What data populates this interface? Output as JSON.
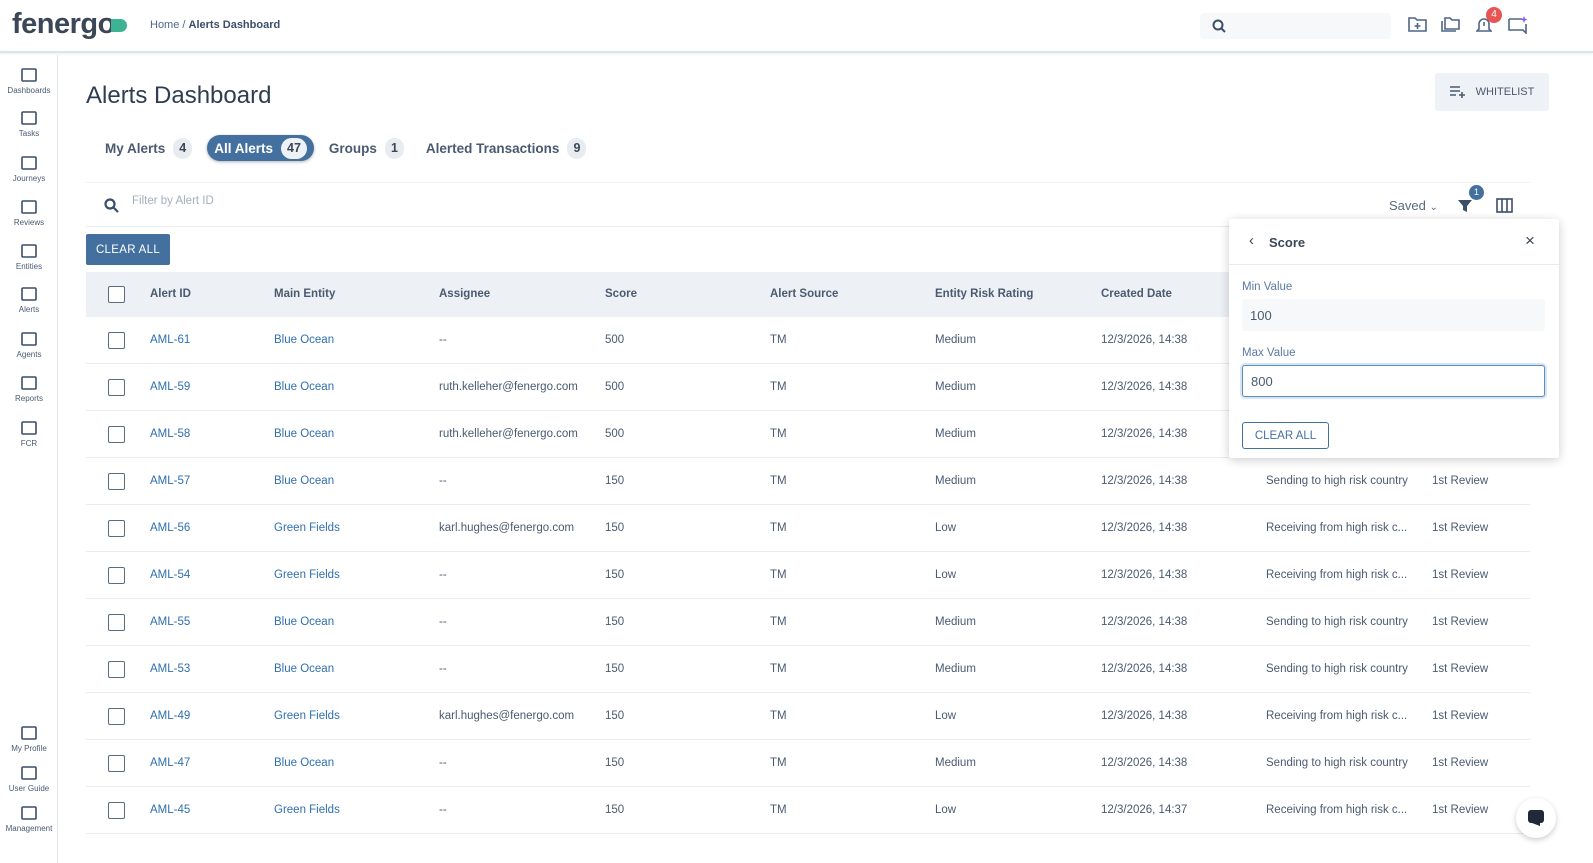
{
  "header": {
    "logo": "fenergo",
    "breadcrumb_home": "Home",
    "breadcrumb_sep": " / ",
    "breadcrumb_current": "Alerts Dashboard",
    "notification_count": "4"
  },
  "sidebar": {
    "items": [
      {
        "label": "Dashboards",
        "icon": "dashboard-icon"
      },
      {
        "label": "Tasks",
        "icon": "tasks-icon"
      },
      {
        "label": "Journeys",
        "icon": "journeys-icon"
      },
      {
        "label": "Reviews",
        "icon": "reviews-icon"
      },
      {
        "label": "Entities",
        "icon": "entities-icon"
      },
      {
        "label": "Alerts",
        "icon": "alerts-icon"
      },
      {
        "label": "Agents",
        "icon": "agents-icon"
      },
      {
        "label": "Reports",
        "icon": "reports-icon"
      },
      {
        "label": "FCR",
        "icon": "fcr-icon"
      }
    ],
    "bottom": [
      {
        "label": "My Profile",
        "icon": "profile-icon"
      },
      {
        "label": "User Guide",
        "icon": "book-icon"
      },
      {
        "label": "Management",
        "icon": "gear-icon"
      }
    ]
  },
  "page": {
    "title": "Alerts Dashboard",
    "whitelist_label": "WHITELIST"
  },
  "tabs": [
    {
      "label": "My Alerts",
      "count": "4"
    },
    {
      "label": "All Alerts",
      "count": "47",
      "active": true
    },
    {
      "label": "Groups",
      "count": "1"
    },
    {
      "label": "Alerted Transactions",
      "count": "9"
    }
  ],
  "filter": {
    "placeholder": "Filter by Alert ID",
    "saved_label": "Saved",
    "filter_count": "1",
    "clear_all": "CLEAR ALL"
  },
  "table": {
    "columns": [
      "Alert ID",
      "Main Entity",
      "Assignee",
      "Score",
      "Alert Source",
      "Entity Risk Rating",
      "Created Date"
    ],
    "rows": [
      [
        "AML-61",
        "Blue Ocean",
        "--",
        "500",
        "TM",
        "Medium",
        "12/3/2026, 14:38",
        "",
        ""
      ],
      [
        "AML-59",
        "Blue Ocean",
        "ruth.kelleher@fenergo.com",
        "500",
        "TM",
        "Medium",
        "12/3/2026, 14:38",
        "",
        ""
      ],
      [
        "AML-58",
        "Blue Ocean",
        "ruth.kelleher@fenergo.com",
        "500",
        "TM",
        "Medium",
        "12/3/2026, 14:38",
        "",
        ""
      ],
      [
        "AML-57",
        "Blue Ocean",
        "--",
        "150",
        "TM",
        "Medium",
        "12/3/2026, 14:38",
        "Sending to high risk country",
        "1st Review"
      ],
      [
        "AML-56",
        "Green Fields",
        "karl.hughes@fenergo.com",
        "150",
        "TM",
        "Low",
        "12/3/2026, 14:38",
        "Receiving from high risk c...",
        "1st Review"
      ],
      [
        "AML-54",
        "Green Fields",
        "--",
        "150",
        "TM",
        "Low",
        "12/3/2026, 14:38",
        "Receiving from high risk c...",
        "1st Review"
      ],
      [
        "AML-55",
        "Blue Ocean",
        "--",
        "150",
        "TM",
        "Medium",
        "12/3/2026, 14:38",
        "Sending to high risk country",
        "1st Review"
      ],
      [
        "AML-53",
        "Blue Ocean",
        "--",
        "150",
        "TM",
        "Medium",
        "12/3/2026, 14:38",
        "Sending to high risk country",
        "1st Review"
      ],
      [
        "AML-49",
        "Green Fields",
        "karl.hughes@fenergo.com",
        "150",
        "TM",
        "Low",
        "12/3/2026, 14:38",
        "Receiving from high risk c...",
        "1st Review"
      ],
      [
        "AML-47",
        "Blue Ocean",
        "--",
        "150",
        "TM",
        "Medium",
        "12/3/2026, 14:38",
        "Sending to high risk country",
        "1st Review"
      ],
      [
        "AML-45",
        "Green Fields",
        "--",
        "150",
        "TM",
        "Low",
        "12/3/2026, 14:37",
        "Receiving from high risk c...",
        "1st Review"
      ]
    ]
  },
  "score_popover": {
    "title": "Score",
    "min_label": "Min Value",
    "min_value": "100",
    "max_label": "Max Value",
    "max_value": "800",
    "clear_all": "CLEAR ALL"
  },
  "colors": {
    "primary": "#44709f",
    "link": "#2f6fb0",
    "badge": "#e85555",
    "logo_accent": "#3cb493"
  }
}
